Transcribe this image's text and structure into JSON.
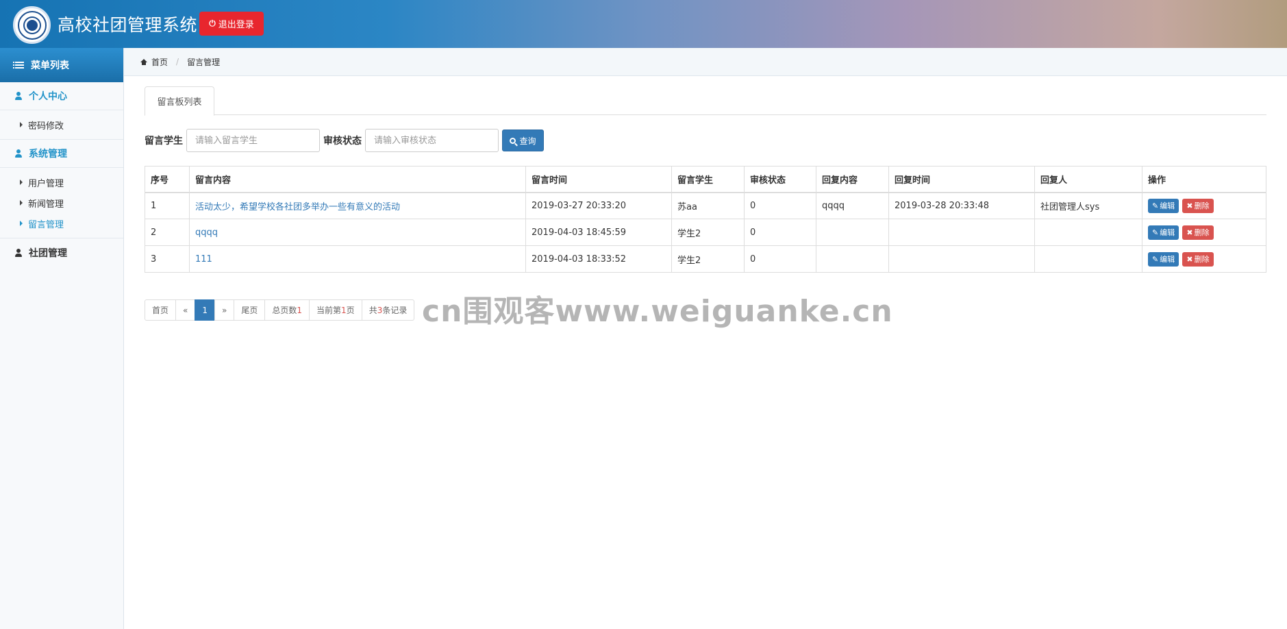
{
  "header": {
    "app_title": "高校社团管理系统",
    "logout_label": "退出登录"
  },
  "sidebar": {
    "menu_title": "菜单列表",
    "groups": [
      {
        "label": "个人中心",
        "items": [
          "密码修改"
        ]
      },
      {
        "label": "系统管理",
        "items": [
          "用户管理",
          "新闻管理",
          "留言管理"
        ]
      },
      {
        "label": "社团管理",
        "items": []
      }
    ]
  },
  "breadcrumb": {
    "home": "首页",
    "current": "留言管理"
  },
  "tab": {
    "label": "留言板列表"
  },
  "search": {
    "student_label": "留言学生",
    "student_placeholder": "请输入留言学生",
    "status_label": "审核状态",
    "status_placeholder": "请输入审核状态",
    "query_label": "查询"
  },
  "table": {
    "headers": [
      "序号",
      "留言内容",
      "留言时间",
      "留言学生",
      "审核状态",
      "回复内容",
      "回复时间",
      "回复人",
      "操作"
    ],
    "rows": [
      [
        "1",
        "活动太少，希望学校各社团多举办一些有意义的活动",
        "2019-03-27 20:33:20",
        "苏aa",
        "0",
        "qqqq",
        "2019-03-28 20:33:48",
        "社团管理人sys"
      ],
      [
        "2",
        "qqqq",
        "2019-04-03 18:45:59",
        "学生2",
        "0",
        "",
        "",
        ""
      ],
      [
        "3",
        "111",
        "2019-04-03 18:33:52",
        "学生2",
        "0",
        "",
        "",
        ""
      ]
    ],
    "edit_label": "编辑",
    "delete_label": "删除"
  },
  "pager": {
    "first": "首页",
    "prev": "«",
    "current": "1",
    "next": "»",
    "last": "尾页",
    "total_pages_prefix": "总页数",
    "total_pages": "1",
    "current_page_prefix": "当前第",
    "current_page": "1",
    "current_page_suffix": "页",
    "total_records_prefix": "共",
    "total_records": "3",
    "total_records_suffix": "条记录"
  },
  "watermark": "cn围观客www.weiguanke.cn"
}
